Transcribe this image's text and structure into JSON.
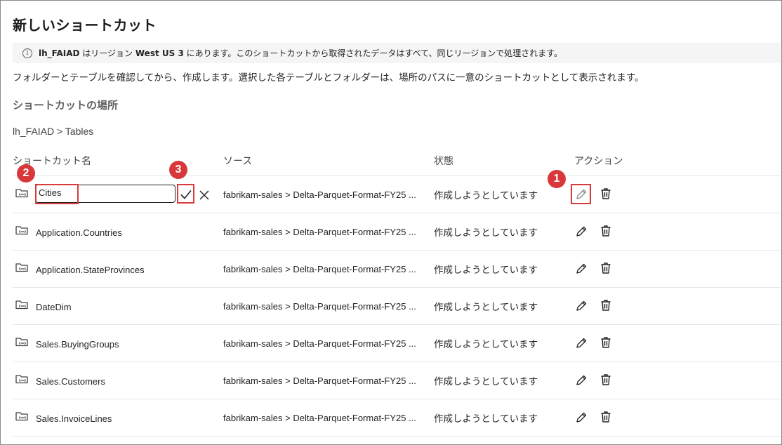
{
  "dialog": {
    "title": "新しいショートカット",
    "info": {
      "lakehouse": "lh_FAIAD",
      "text1": " はリージョン ",
      "region": "West US 3",
      "text2": " にあります。このショートカットから取得されたデータはすべて、同じリージョンで処理されます。"
    },
    "description": "フォルダーとテーブルを確認してから、作成します。選択した各テーブルとフォルダーは、場所のパスに一意のショートカットとして表示されます。",
    "location_heading": "ショートカットの場所",
    "breadcrumb": "lh_FAIAD > Tables"
  },
  "table": {
    "headers": {
      "name": "ショートカット名",
      "source": "ソース",
      "status": "状態",
      "actions": "アクション"
    },
    "editing_value": "Cities",
    "rows": [
      {
        "name": "Cities",
        "source": "fabrikam-sales > Delta-Parquet-Format-FY25 ...",
        "status": "作成しようとしています"
      },
      {
        "name": "Application.Countries",
        "source": "fabrikam-sales > Delta-Parquet-Format-FY25 ...",
        "status": "作成しようとしています"
      },
      {
        "name": "Application.StateProvinces",
        "source": "fabrikam-sales > Delta-Parquet-Format-FY25 ...",
        "status": "作成しようとしています"
      },
      {
        "name": "DateDim",
        "source": "fabrikam-sales > Delta-Parquet-Format-FY25 ...",
        "status": "作成しようとしています"
      },
      {
        "name": "Sales.BuyingGroups",
        "source": "fabrikam-sales > Delta-Parquet-Format-FY25 ...",
        "status": "作成しようとしています"
      },
      {
        "name": "Sales.Customers",
        "source": "fabrikam-sales > Delta-Parquet-Format-FY25 ...",
        "status": "作成しようとしています"
      },
      {
        "name": "Sales.InvoiceLines",
        "source": "fabrikam-sales > Delta-Parquet-Format-FY25 ...",
        "status": "作成しようとしています"
      }
    ]
  },
  "annotations": {
    "badge1": "1",
    "badge2": "2",
    "badge3": "3"
  },
  "icons": {
    "folder": "folder-link-icon",
    "edit": "pencil-icon",
    "delete": "trash-icon",
    "confirm": "checkmark-icon",
    "cancel": "close-icon",
    "info": "info-icon"
  },
  "colors": {
    "annotation": "#d83b3b",
    "info_bg": "#f5f5f5",
    "row_divider": "#e6e6e6"
  }
}
